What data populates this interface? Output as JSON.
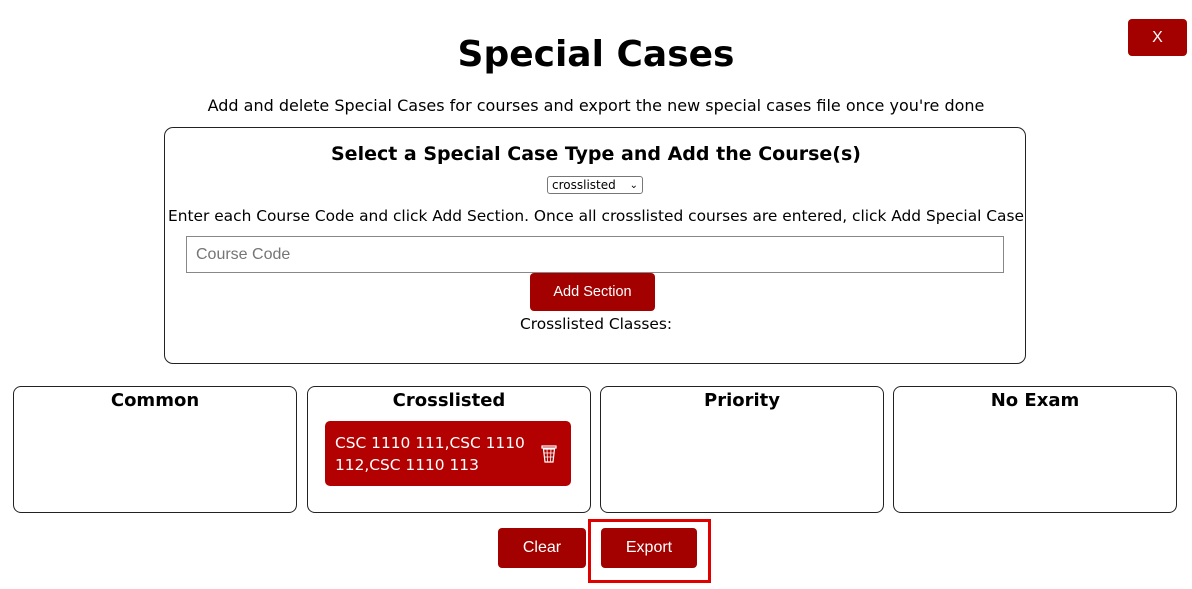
{
  "header": {
    "close_label": "X",
    "title": "Special Cases",
    "subtitle": "Add and delete Special Cases for courses and export the new special cases file once you're done"
  },
  "form": {
    "title": "Select a Special Case Type and Add the Course(s)",
    "type_select": {
      "selected": "crosslisted"
    },
    "instructions": "Enter each Course Code and click Add Section. Once all crosslisted courses are entered, click Add Special Case",
    "course_code": {
      "value": "",
      "placeholder": "Course Code"
    },
    "add_section_label": "Add Section",
    "crosslisted_label": "Crosslisted Classes:"
  },
  "categories": [
    {
      "title": "Common",
      "items": []
    },
    {
      "title": "Crosslisted",
      "items": [
        "CSC 1110 111,CSC 1110 112,CSC 1110 113"
      ]
    },
    {
      "title": "Priority",
      "items": []
    },
    {
      "title": "No Exam",
      "items": []
    }
  ],
  "actions": {
    "clear_label": "Clear",
    "export_label": "Export"
  },
  "icons": {
    "delete": "trash-icon"
  },
  "colors": {
    "accent": "#a30000",
    "case_item": "#b30000",
    "highlight": "#e00000"
  }
}
